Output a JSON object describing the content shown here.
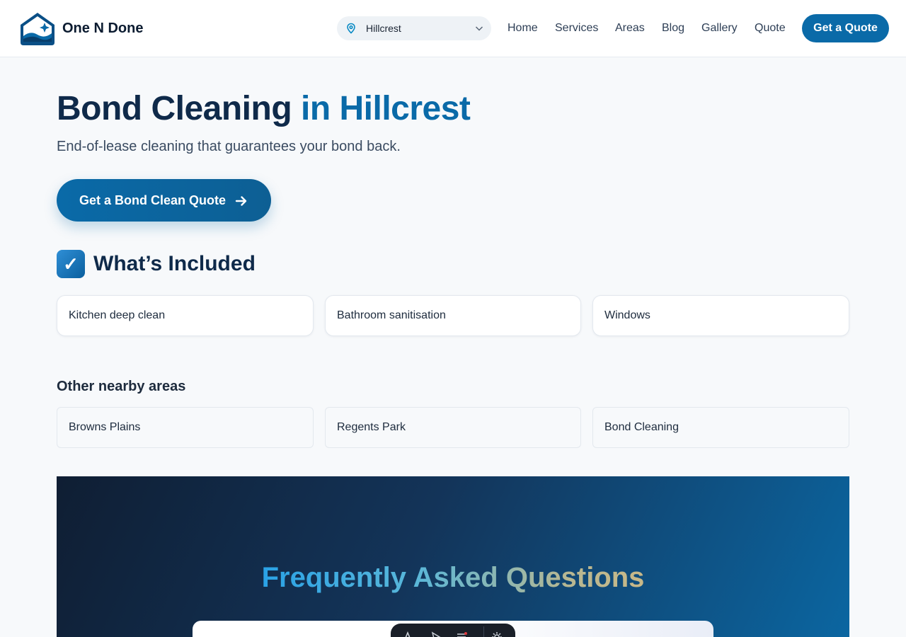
{
  "header": {
    "brand": "One N Done",
    "location": {
      "selected": "Hillcrest"
    },
    "nav": [
      "Home",
      "Services",
      "Areas",
      "Blog",
      "Gallery",
      "Quote"
    ],
    "cta": "Get a Quote"
  },
  "hero": {
    "title_main": "Bond Cleaning",
    "title_accent": "in Hillcrest",
    "subtitle": "End-of-lease cleaning that guarantees your bond back.",
    "cta": "Get a Bond Clean Quote"
  },
  "included": {
    "title": "What’s Included",
    "icon": "check-icon",
    "check_glyph": "✓",
    "items": [
      "Kitchen deep clean",
      "Bathroom sanitisation",
      "Windows"
    ]
  },
  "nearby": {
    "title": "Other nearby areas",
    "items": [
      "Browns Plains",
      "Regents Park",
      "Bond Cleaning"
    ]
  },
  "faq": {
    "title": "Frequently Asked Questions"
  },
  "colors": {
    "primary": "#0a6aa8",
    "heading": "#0f2a4a",
    "background": "#f7f9fb"
  }
}
